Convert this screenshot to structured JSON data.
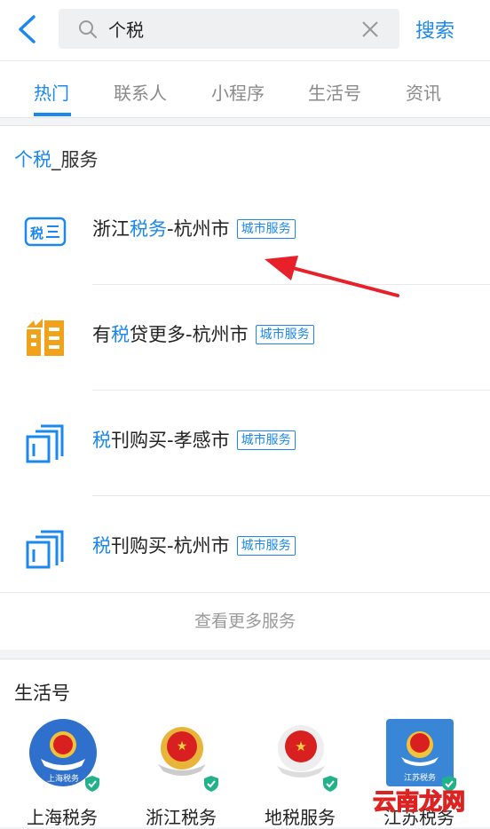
{
  "header": {
    "search_value": "个税",
    "search_button": "搜索"
  },
  "tabs": [
    "热门",
    "联系人",
    "小程序",
    "生活号",
    "资讯"
  ],
  "services": {
    "title_highlight": "个税",
    "title_rest": "_服务",
    "items": [
      {
        "before": "浙江",
        "hl": "税务",
        "after": "-杭州市",
        "tag": "城市服务",
        "icon": "tax-card-icon"
      },
      {
        "before": "有",
        "hl": "税",
        "after": "贷更多-杭州市",
        "tag": "城市服务",
        "icon": "tax-loan-icon"
      },
      {
        "before": "",
        "hl": "税",
        "after": "刊购买-孝感市",
        "tag": "城市服务",
        "icon": "magazine-icon"
      },
      {
        "before": "",
        "hl": "税",
        "after": "刊购买-杭州市",
        "tag": "城市服务",
        "icon": "magazine-icon"
      }
    ],
    "more": "查看更多服务"
  },
  "life": {
    "title": "生活号",
    "accounts": [
      {
        "label": "上海税务",
        "badge_text": "上海税务"
      },
      {
        "label": "浙江税务"
      },
      {
        "label": "地税服务"
      },
      {
        "label": "江苏税务",
        "badge_text": "江苏税务"
      }
    ]
  },
  "watermark": "云南龙网",
  "colors": {
    "accent": "#1b88ee",
    "tax_orange": "#f0a21a",
    "verified_green": "#21b28a",
    "annotation_red": "#e8202a"
  }
}
